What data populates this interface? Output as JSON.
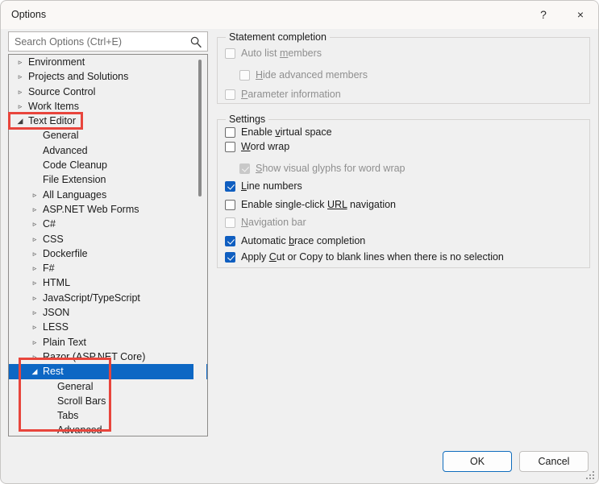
{
  "window": {
    "title": "Options",
    "help_label": "?",
    "close_label": "×"
  },
  "search": {
    "placeholder": "Search Options (Ctrl+E)",
    "value": "",
    "icon": "search-icon"
  },
  "tree": {
    "nodes": [
      {
        "label": "Environment",
        "level": 1,
        "state": "collapsed",
        "selected": false
      },
      {
        "label": "Projects and Solutions",
        "level": 1,
        "state": "collapsed",
        "selected": false
      },
      {
        "label": "Source Control",
        "level": 1,
        "state": "collapsed",
        "selected": false
      },
      {
        "label": "Work Items",
        "level": 1,
        "state": "collapsed",
        "selected": false
      },
      {
        "label": "Text Editor",
        "level": 1,
        "state": "expanded",
        "selected": false
      },
      {
        "label": "General",
        "level": 2,
        "state": "leaf",
        "selected": false
      },
      {
        "label": "Advanced",
        "level": 2,
        "state": "leaf",
        "selected": false
      },
      {
        "label": "Code Cleanup",
        "level": 2,
        "state": "leaf",
        "selected": false
      },
      {
        "label": "File Extension",
        "level": 2,
        "state": "leaf",
        "selected": false
      },
      {
        "label": "All Languages",
        "level": 2,
        "state": "collapsed",
        "selected": false
      },
      {
        "label": "ASP.NET Web Forms",
        "level": 2,
        "state": "collapsed",
        "selected": false
      },
      {
        "label": "C#",
        "level": 2,
        "state": "collapsed",
        "selected": false
      },
      {
        "label": "CSS",
        "level": 2,
        "state": "collapsed",
        "selected": false
      },
      {
        "label": "Dockerfile",
        "level": 2,
        "state": "collapsed",
        "selected": false
      },
      {
        "label": "F#",
        "level": 2,
        "state": "collapsed",
        "selected": false
      },
      {
        "label": "HTML",
        "level": 2,
        "state": "collapsed",
        "selected": false
      },
      {
        "label": "JavaScript/TypeScript",
        "level": 2,
        "state": "collapsed",
        "selected": false
      },
      {
        "label": "JSON",
        "level": 2,
        "state": "collapsed",
        "selected": false
      },
      {
        "label": "LESS",
        "level": 2,
        "state": "collapsed",
        "selected": false
      },
      {
        "label": "Plain Text",
        "level": 2,
        "state": "collapsed",
        "selected": false
      },
      {
        "label": "Razor (ASP.NET Core)",
        "level": 2,
        "state": "collapsed",
        "selected": false
      },
      {
        "label": "Rest",
        "level": 2,
        "state": "expanded",
        "selected": true
      },
      {
        "label": "General",
        "level": 3,
        "state": "leaf",
        "selected": false
      },
      {
        "label": "Scroll Bars",
        "level": 3,
        "state": "leaf",
        "selected": false
      },
      {
        "label": "Tabs",
        "level": 3,
        "state": "leaf",
        "selected": false
      },
      {
        "label": "Advanced",
        "level": 3,
        "state": "leaf",
        "selected": false
      }
    ],
    "glyphs": {
      "collapsed": "▹",
      "expanded": "◢"
    }
  },
  "annotations": {
    "highlight_color": "#e8453c",
    "boxes": [
      {
        "name": "text-editor-node"
      },
      {
        "name": "rest-node-group"
      }
    ]
  },
  "panel": {
    "groups": [
      {
        "title": "Statement completion",
        "items": [
          {
            "label_before": "Auto list ",
            "accel": "m",
            "label_after": "embers",
            "checked": false,
            "enabled": false,
            "indent": 0
          },
          {
            "label_before": "",
            "accel": "H",
            "label_after": "ide advanced members",
            "checked": false,
            "enabled": false,
            "indent": 1
          },
          {
            "label_before": "",
            "accel": "P",
            "label_after": "arameter information",
            "checked": false,
            "enabled": false,
            "indent": 0
          }
        ]
      },
      {
        "title": "Settings",
        "items": [
          {
            "label_before": "Enable ",
            "accel": "v",
            "label_after": "irtual space",
            "checked": false,
            "enabled": true,
            "indent": 0
          },
          {
            "label_before": "",
            "accel": "W",
            "label_after": "ord wrap",
            "checked": false,
            "enabled": true,
            "indent": 0
          },
          {
            "label_before": "",
            "accel": "S",
            "label_after": "how visual glyphs for word wrap",
            "checked": true,
            "enabled": false,
            "indent": 1
          },
          {
            "label_before": "",
            "accel": "L",
            "label_after": "ine numbers",
            "checked": true,
            "enabled": true,
            "indent": 0
          },
          {
            "label_before": "Enable single-click ",
            "accel": "URL",
            "label_after": " navigation",
            "checked": false,
            "enabled": true,
            "indent": 0
          },
          {
            "label_before": "",
            "accel": "N",
            "label_after": "avigation bar",
            "checked": false,
            "enabled": false,
            "indent": 0
          },
          {
            "label_before": "Automatic ",
            "accel": "b",
            "label_after": "race completion",
            "checked": true,
            "enabled": true,
            "indent": 0
          },
          {
            "label_before": "Apply ",
            "accel": "C",
            "label_after": "ut or Copy to blank lines when there is no selection",
            "checked": true,
            "enabled": true,
            "indent": 0
          }
        ]
      }
    ]
  },
  "footer": {
    "ok_label": "OK",
    "cancel_label": "Cancel"
  }
}
